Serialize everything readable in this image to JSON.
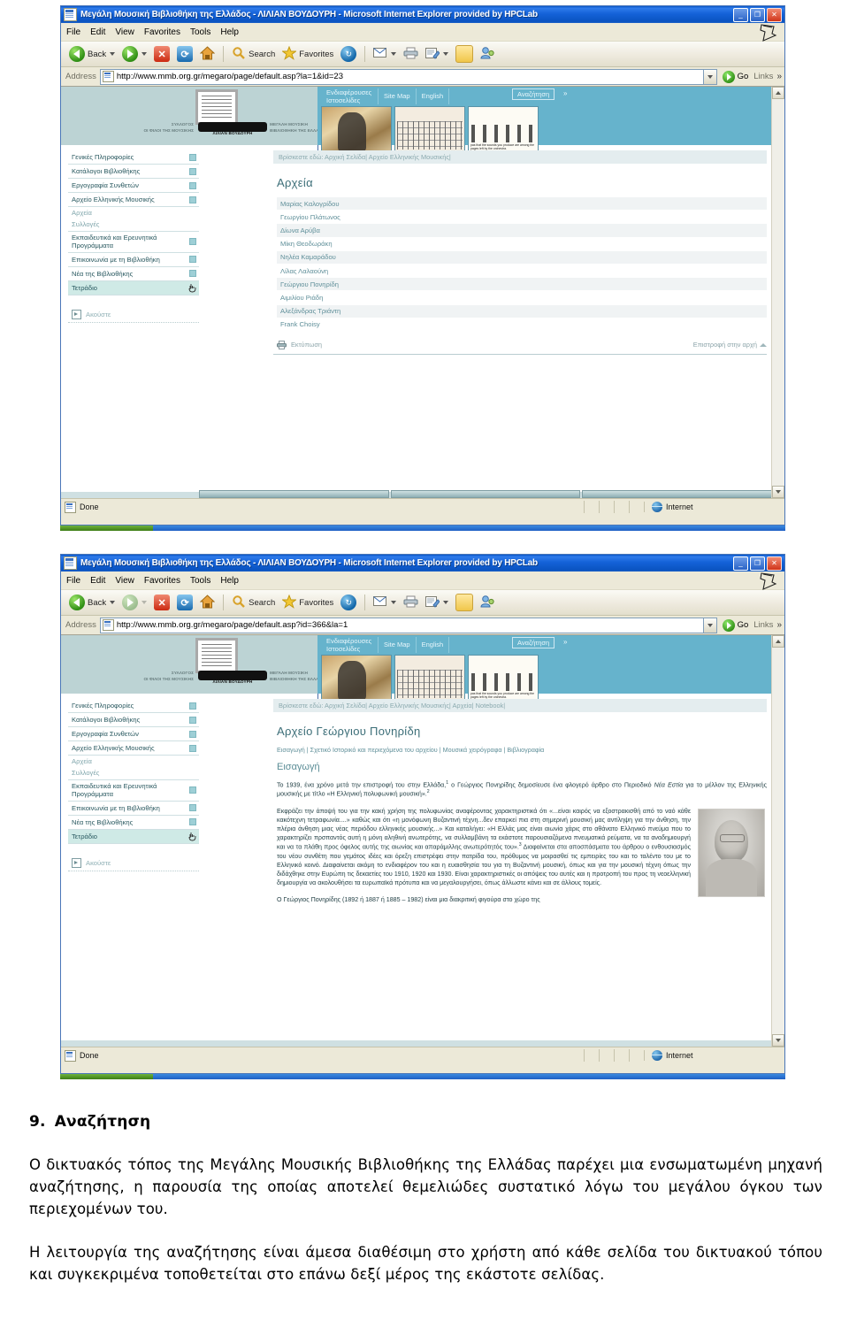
{
  "browser": {
    "title": "Μεγάλη Μουσική Βιβλιοθήκη της Ελλάδος - ΛΙΛΙΑΝ ΒΟΥΔΟΥΡΗ - Microsoft Internet Explorer provided by HPCLab",
    "menu": [
      "File",
      "Edit",
      "View",
      "Favorites",
      "Tools",
      "Help"
    ],
    "toolbar": {
      "back": "Back",
      "forward": "",
      "stop": "",
      "refresh": "",
      "home": "",
      "search": "Search",
      "favorites": "Favorites",
      "history": "",
      "mail": "",
      "print": "",
      "edit": "",
      "discuss": "",
      "messenger": ""
    },
    "address": {
      "label": "Address",
      "url_1": "http://www.mmb.org.gr/megaro/page/default.asp?la=1&id=23",
      "url_2": "http://www.mmb.org.gr/megaro/page/default.asp?id=366&la=1",
      "go": "Go",
      "links": "Links"
    },
    "status": {
      "text": "Done",
      "zone": "Internet"
    },
    "window_buttons": {
      "minimize": "_",
      "maximize": "❐",
      "close": "✕"
    }
  },
  "site": {
    "logo": {
      "left_line1": "ΣΥΛΛΟΓΟΣ",
      "left_line2": "ΟΙ ΦΙΛΟΙ ΤΗΣ ΜΟΥΣΙΚΗΣ",
      "right_line1": "ΜΕΓΑΛΗ ΜΟΥΣΙΚΗ",
      "right_line2": "ΒΙΒΛΙΟΘΗΚΗ ΤΗΣ ΕΛΛΑΔΟΣ",
      "sub": "ΛΙΛΙΑΝ ΒΟΥΔΟΥΡΗ"
    },
    "topnav": [
      "Ενδιαφέρουσες Ιστοσελίδες",
      "Site Map",
      "English"
    ],
    "search_button": "Αναζήτηση",
    "search_chevron": "»",
    "thumb_captions": {
      "t3": "pas that the sounds you produce are among the pages left by the orchestra."
    },
    "sidebar": [
      {
        "label": "Γενικές Πληροφορίες",
        "box": true,
        "sub": false
      },
      {
        "label": "Κατάλογοι Βιβλιοθήκης",
        "box": true,
        "sub": false
      },
      {
        "label": "Εργογραφία Συνθετών",
        "box": true,
        "sub": false
      },
      {
        "label": "Αρχείο Ελληνικής Μουσικής",
        "box": true,
        "sub": false
      },
      {
        "label": "Αρχεία",
        "box": false,
        "sub": true
      },
      {
        "label": "Συλλογές",
        "box": false,
        "sub": true
      },
      {
        "label": "Εκπαιδευτικά και Ερευνητικά Προγράμματα",
        "box": true,
        "sub": false
      },
      {
        "label": "Επικοινωνία με τη Βιβλιοθήκη",
        "box": true,
        "sub": false
      },
      {
        "label": "Νέα της Βιβλιοθήκης",
        "box": true,
        "sub": false
      },
      {
        "label": "Τετράδιο",
        "box": false,
        "sub": false,
        "highlighted": true
      }
    ],
    "listen_label": "Ακούστε"
  },
  "page1": {
    "breadcrumb": "Βρίσκεστε εδώ: Αρχική Σελίδα| Αρχείο Ελληνικής Μουσικής|",
    "title": "Αρχεία",
    "items": [
      "Μαρίας Καλογρίδου",
      "Γεωργίου Πλάτωνος",
      "Δίωνα Αρύβα",
      "Μίκη Θεοδωράκη",
      "Νηλέα Καμαράδου",
      "Λίλας Λαλαούνη",
      "Γεώργιου Πονηρίδη",
      "Αιμιλίου Ριάδη",
      "Αλεξάνδρας Τριάντη",
      "Frank Choisy"
    ],
    "print_label": "Εκτύπωση",
    "back_to_top": "Επιστροφή στην αρχή"
  },
  "page2": {
    "breadcrumb": "Βρίσκεστε εδώ: Αρχική Σελίδα| Αρχείο Ελληνικής Μουσικής| Αρχεία| Notebook|",
    "title": "Αρχείο Γεώργιου Πονηρίδη",
    "tabs": "Εισαγωγή | Σχετικό Ιστορικό και περιεχόμενα του αρχείου | Μουσικά χειρόγραφα | Βιβλιογραφία",
    "section": "Εισαγωγή",
    "para1_a": "Το 1939, ένα χρόνο μετά την επιστροφή του στην Ελλάδα,",
    "para1_sup1": "1",
    "para1_b": "ο Γεώργιος Πονηρίδης δημοσίευσε ένα φλογερό άρθρο στο Περιοδικό",
    "para1_italic": "Νέα Εστία",
    "para1_c": "για το μέλλον της Ελληνικής μουσικής με τίτλο «Η Ελληνική πολυφωνική μουσική».",
    "para1_sup2": "2",
    "para2_a": "Εκφράζει την άποψή του για την κακή χρήση της πολυφωνίας αναφέροντας χαρακτηριστικά ότι «...είναι καιρός να εξοστρακισθή από το ναό κάθε κακότεχνη τετραφωνία....» καθώς και ότι «η μονόφωνη Βυζαντινή τέχνη...δεν επαρκεί πια στη σημερινή μουσική μας αντίληψη για την άνθηση, την πλέρια άνθηση μιας νέας περιόδου ελληνικής μουσικής...» Και καταλήγει: «Η Ελλάς μας είναι αιωνία χάρις στο αθάνατο Ελληνικό πνεύμα που το χαρακτηρίζει πρσπαντός αυτή η μόνη αληθινή ανωτερότης, να συλλαμβάνη τα εκάστοτε παρουσιαζόμενα πνευματικά ρεύματα, να τα αναδημιουργή και να τα πλάθη προς όφελος αυτής της αιωνίας και απαράμιλλης ανωτερότητός του».",
    "para2_sup": "3",
    "para2_b": "Διαφαίνεται στα αποσπάσματα του άρθρου ο ενθουσιασμός του νέου συνθέτη που γεμάτος ιδέες και όρεξη επιστρέφει στην πατρίδα του, πρόθυμος να μοιρασθεί τις εμπειρίες του και το ταλέντο του με το Ελληνικό κοινό. Διαφαίνεται ακόμη το ενδιαφέρον του και η ευαισθησία του για τη Βυζαντινή μουσική, όπως και για την μουσική τέχνη όπως την διδάχθηκε στην Ευρώπη τις δεκαετίες του 1910, 1920 και 1930. Είναι χαρακτηριστικές οι απόψεις του αυτές και η προτροπή του προς τη νεοελληνική δημιουργία να ακολουθήσει τα ευρωπαϊκά πρότυπα και να μεγαλουργήσει, όπως άλλωστε κάνει και σε άλλους τομείς.",
    "para3": "Ο Γεώργιος Πονηρίδης (1892 ή 1887 ή 1885 – 1982) είναι μια διακριτική φιγούρα στο χώρο της"
  },
  "document": {
    "heading_number": "9.",
    "heading_text": "Αναζήτηση",
    "paragraph1": "Ο δικτυακός τόπος της Μεγάλης Μουσικής Βιβλιοθήκης της Ελλάδας παρέχει μια ενσωματωμένη μηχανή αναζήτησης, η παρουσία της οποίας αποτελεί θεμελιώδες συστατικό λόγω του μεγάλου όγκου των περιεχομένων του.",
    "paragraph2": "Η λειτουργία της αναζήτησης είναι άμεσα διαθέσιμη στο χρήστη από κάθε σελίδα του δικτυακού τόπου και συγκεκριμένα τοποθετείται στο επάνω δεξί μέρος της εκάστοτε σελίδας."
  },
  "colors": {
    "title_bar_blue": "#0a55c8",
    "banner_teal": "#bcd3d4",
    "banner_cyan": "#66b3cc",
    "accent_text": "#3c6e78",
    "sidebar_highlight": "#cfeae6"
  }
}
